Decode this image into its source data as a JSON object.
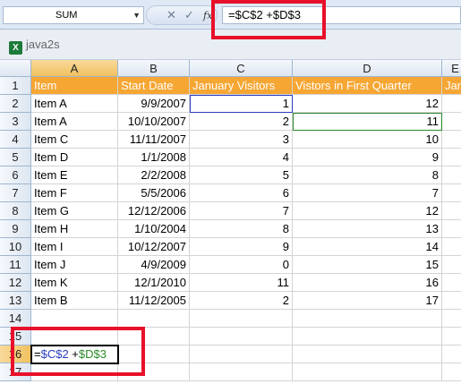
{
  "formula_bar": {
    "name_box": "SUM",
    "formula_parts": [
      "=",
      "$C$2",
      " +",
      "$D$3"
    ]
  },
  "window": {
    "title": "java2s",
    "icon": "excel-icon"
  },
  "columns": [
    "A",
    "B",
    "C",
    "D",
    "E"
  ],
  "header_row": [
    "Item",
    "Start Date",
    "January Visitors",
    "Vistors in First Quarter",
    "Jan"
  ],
  "rows": [
    [
      "Item A",
      "9/9/2007",
      "1",
      "12"
    ],
    [
      "Item A",
      "10/10/2007",
      "2",
      "11"
    ],
    [
      "Item C",
      "11/11/2007",
      "3",
      "10"
    ],
    [
      "Item D",
      "1/1/2008",
      "4",
      "9"
    ],
    [
      "Item E",
      "2/2/2008",
      "5",
      "8"
    ],
    [
      "Item F",
      "5/5/2006",
      "6",
      "7"
    ],
    [
      "Item G",
      "12/12/2006",
      "7",
      "12"
    ],
    [
      "Item H",
      "1/10/2004",
      "8",
      "13"
    ],
    [
      "Item I",
      "10/12/2007",
      "9",
      "14"
    ],
    [
      "Item J",
      "4/9/2009",
      "0",
      "15"
    ],
    [
      "Item K",
      "12/1/2010",
      "11",
      "16"
    ],
    [
      "Item B",
      "11/12/2005",
      "2",
      "17"
    ]
  ],
  "row_numbers": [
    "1",
    "2",
    "3",
    "4",
    "5",
    "6",
    "7",
    "8",
    "9",
    "10",
    "11",
    "12",
    "13",
    "14",
    "15",
    "16",
    "17"
  ],
  "active_cell_parts": [
    "=",
    "$C$2",
    " +",
    "$D$3"
  ],
  "colors": {
    "header_fill": "#f6a633",
    "ref_blue": "#2a3cbf",
    "ref_green": "#2a8a2a",
    "highlight": "#e8102a"
  }
}
